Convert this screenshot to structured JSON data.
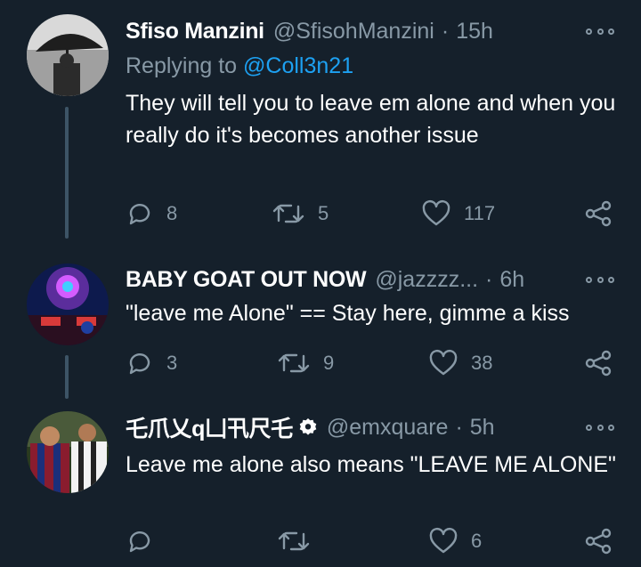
{
  "tweets": [
    {
      "name": "Sfiso Manzini",
      "handle": "@SfisohManzini",
      "separator": "·",
      "time": "15h",
      "reply_prefix": "Replying to",
      "reply_mention": "@Coll3n21",
      "text": "They will tell you to leave em alone and when you really do it's becomes another issue",
      "replies": "8",
      "retweets": "5",
      "likes": "117",
      "avatar_icon": "umbrella-photo-avatar"
    },
    {
      "name": "BABY GOAT OUT NOW",
      "handle": "@jazzzz...",
      "separator": "·",
      "time": "6h",
      "text": "\"leave me Alone\" == Stay here, gimme a kiss",
      "replies": "3",
      "retweets": "9",
      "likes": "38",
      "avatar_icon": "stage-photo-avatar"
    },
    {
      "name": "乇爪乂q凵卂尺乇",
      "handle": "@emxquare",
      "separator": "·",
      "time": "5h",
      "text": "Leave me alone also means \"LEAVE ME ALONE\"",
      "replies": "",
      "retweets": "",
      "likes": "6",
      "avatar_icon": "footballers-photo-avatar",
      "badge_icon": "verified-badge-icon"
    }
  ],
  "colors": {
    "background": "#15202b",
    "text_primary": "#ffffff",
    "text_secondary": "#8899a6",
    "link": "#1da1f2",
    "thread_line": "#3d5466"
  }
}
